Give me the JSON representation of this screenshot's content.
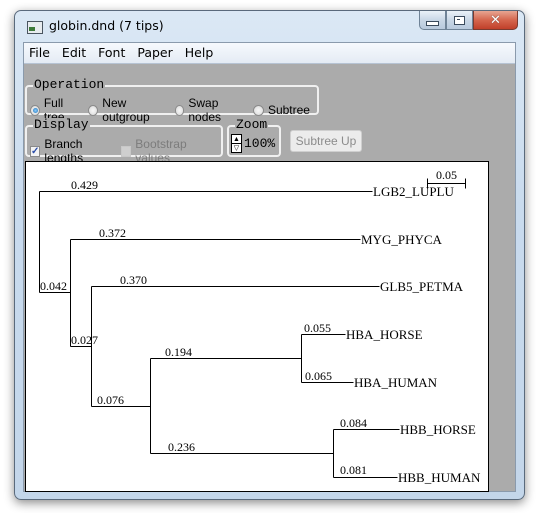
{
  "window": {
    "title": "globin.dnd (7 tips)",
    "app_icon": "window-app-icon",
    "controls": {
      "minimize": "minimize-icon",
      "maximize": "maximize-icon",
      "close": "close-icon"
    }
  },
  "menu": [
    "File",
    "Edit",
    "Font",
    "Paper",
    "Help"
  ],
  "operation": {
    "legend": "Operation",
    "options": [
      {
        "label": "Full tree",
        "checked": true
      },
      {
        "label": "New outgroup",
        "checked": false
      },
      {
        "label": "Swap nodes",
        "checked": false
      },
      {
        "label": "Subtree",
        "checked": false
      }
    ]
  },
  "display": {
    "legend": "Display",
    "branch_lengths": {
      "label": "Branch lengths",
      "checked": true,
      "enabled": true
    },
    "bootstrap_values": {
      "label": "Bootstrap values",
      "checked": false,
      "enabled": false
    }
  },
  "zoom": {
    "legend": "Zoom",
    "value": "100%",
    "up_glyph": "▲",
    "down_glyph": "▽"
  },
  "subtree_up_button": {
    "label": "Subtree Up",
    "enabled": false
  },
  "tree": {
    "scale_bar_label": "0.05",
    "tips": [
      {
        "name": "LGB2_LUPLU",
        "length": "0.429"
      },
      {
        "name": "MYG_PHYCA",
        "length": "0.372"
      },
      {
        "name": "GLB5_PETMA",
        "length": "0.370"
      },
      {
        "name": "HBA_HORSE",
        "length": "0.055"
      },
      {
        "name": "HBA_HUMAN",
        "length": "0.065"
      },
      {
        "name": "HBB_HORSE",
        "length": "0.084"
      },
      {
        "name": "HBB_HUMAN",
        "length": "0.081"
      }
    ],
    "internal_branches": [
      {
        "id": "n1",
        "length": "0.042"
      },
      {
        "id": "n2",
        "length": "0.027"
      },
      {
        "id": "n3",
        "length": "0.076"
      },
      {
        "id": "hba",
        "length": "0.194"
      },
      {
        "id": "hbb",
        "length": "0.236"
      }
    ]
  }
}
